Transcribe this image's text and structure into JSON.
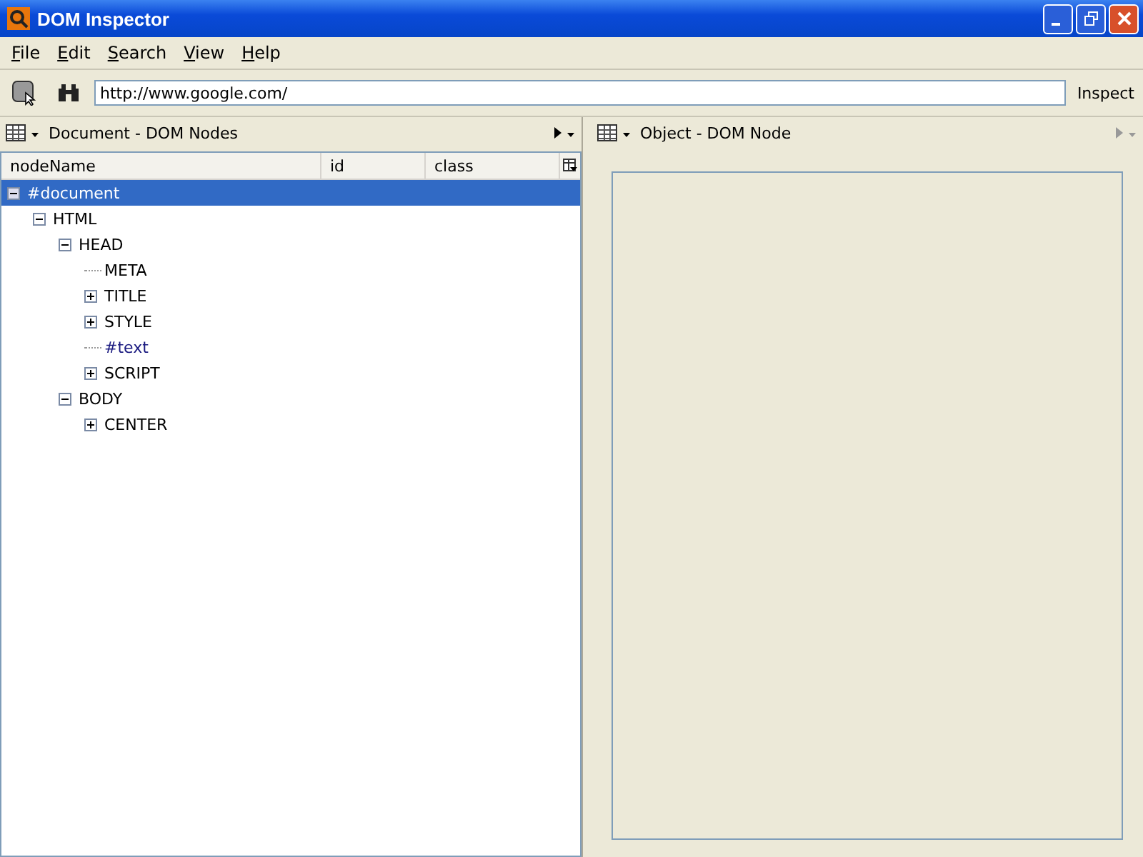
{
  "window": {
    "title": "DOM Inspector"
  },
  "menu": [
    {
      "label": "File"
    },
    {
      "label": "Edit"
    },
    {
      "label": "Search"
    },
    {
      "label": "View"
    },
    {
      "label": "Help"
    }
  ],
  "toolbar": {
    "url": "http://www.google.com/",
    "inspect_button": "Inspect"
  },
  "left_panel": {
    "title": "Document - DOM Nodes",
    "columns": [
      "nodeName",
      "id",
      "class"
    ],
    "tree": [
      {
        "name": "#document",
        "kind": "branch",
        "expanded": true,
        "selected": true,
        "children": [
          {
            "name": "HTML",
            "kind": "branch",
            "expanded": true,
            "selected": false,
            "children": [
              {
                "name": "HEAD",
                "kind": "branch",
                "expanded": true,
                "selected": false,
                "children": [
                  {
                    "name": "META",
                    "kind": "leaf",
                    "selected": false
                  },
                  {
                    "name": "TITLE",
                    "kind": "branch",
                    "expanded": false,
                    "selected": false
                  },
                  {
                    "name": "STYLE",
                    "kind": "branch",
                    "expanded": false,
                    "selected": false
                  },
                  {
                    "name": "#text",
                    "kind": "text",
                    "selected": false
                  },
                  {
                    "name": "SCRIPT",
                    "kind": "branch",
                    "expanded": false,
                    "selected": false
                  }
                ]
              },
              {
                "name": "BODY",
                "kind": "branch",
                "expanded": true,
                "selected": false,
                "children": [
                  {
                    "name": "CENTER",
                    "kind": "branch",
                    "expanded": false,
                    "selected": false
                  }
                ]
              }
            ]
          }
        ]
      }
    ]
  },
  "right_panel": {
    "title": "Object - DOM Node"
  }
}
